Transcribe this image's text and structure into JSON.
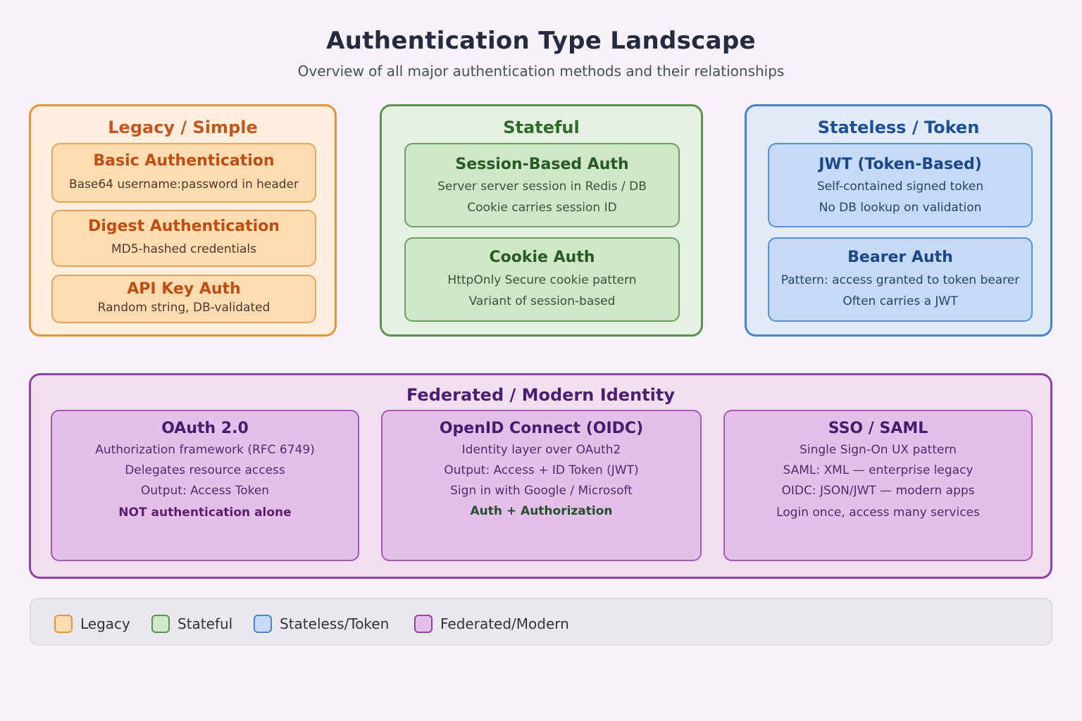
{
  "header": {
    "title": "Authentication Type Landscape",
    "subtitle": "Overview of all major authentication methods and their relationships"
  },
  "groups": {
    "legacy": {
      "title": "Legacy / Simple",
      "cards": [
        {
          "title": "Basic Authentication",
          "lines": [
            "Base64 username:password in header"
          ]
        },
        {
          "title": "Digest Authentication",
          "lines": [
            "MD5-hashed credentials"
          ]
        },
        {
          "title": "API Key Auth",
          "lines": [
            "Random string, DB-validated"
          ]
        }
      ]
    },
    "stateful": {
      "title": "Stateful",
      "cards": [
        {
          "title": "Session-Based Auth",
          "lines": [
            "Server server session in Redis / DB",
            "Cookie carries session ID"
          ]
        },
        {
          "title": "Cookie Auth",
          "lines": [
            "HttpOnly Secure cookie pattern",
            "Variant of session-based"
          ]
        }
      ]
    },
    "stateless": {
      "title": "Stateless / Token",
      "cards": [
        {
          "title": "JWT (Token-Based)",
          "lines": [
            "Self-contained signed token",
            "No DB lookup on validation"
          ]
        },
        {
          "title": "Bearer Auth",
          "lines": [
            "Pattern: access granted to token bearer",
            "Often carries a JWT"
          ]
        }
      ]
    },
    "federated": {
      "title": "Federated / Modern Identity",
      "cards": [
        {
          "title": "OAuth 2.0",
          "lines": [
            "Authorization framework (RFC 6749)",
            "Delegates resource access",
            "Output: Access Token"
          ],
          "emphasis": "NOT authentication alone"
        },
        {
          "title": "OpenID Connect (OIDC)",
          "lines": [
            "Identity layer over OAuth2",
            "Output: Access + ID Token (JWT)",
            "Sign in with Google / Microsoft"
          ],
          "emphasis": "Auth + Authorization"
        },
        {
          "title": "SSO / SAML",
          "lines": [
            "Single Sign-On UX pattern",
            "SAML: XML — enterprise legacy",
            "OIDC: JSON/JWT — modern apps",
            "Login once, access many services"
          ]
        }
      ]
    }
  },
  "legend": {
    "items": [
      {
        "label": "Legacy",
        "fill": "#fddcb2",
        "stroke": "#e8923c"
      },
      {
        "label": "Stateful",
        "fill": "#cfe6c7",
        "stroke": "#5b9054"
      },
      {
        "label": "Stateless/Token",
        "fill": "#c5daf6",
        "stroke": "#4a82cc"
      },
      {
        "label": "Federated/Modern",
        "fill": "#e4c0e9",
        "stroke": "#9441a6"
      }
    ]
  }
}
